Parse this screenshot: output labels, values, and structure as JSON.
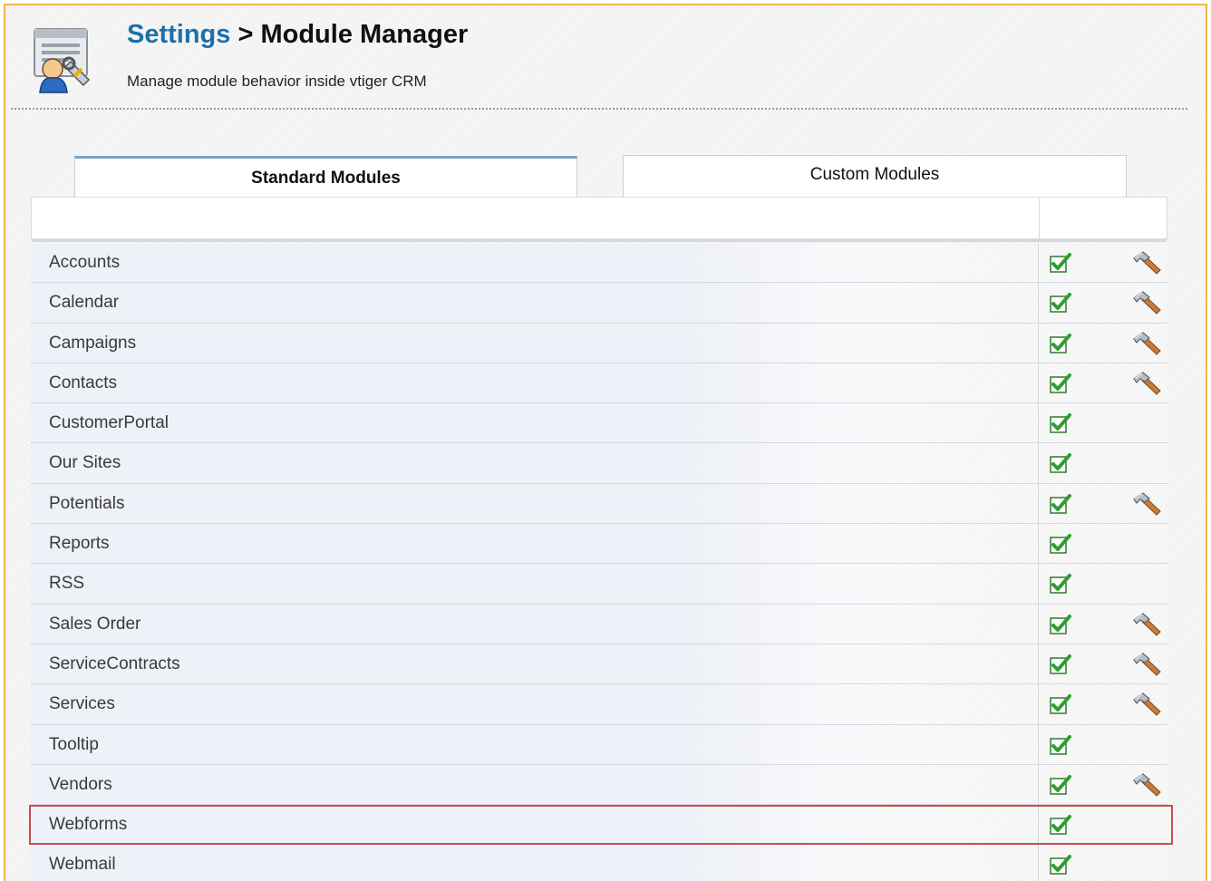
{
  "header": {
    "breadcrumb_link": "Settings",
    "breadcrumb_separator": ">",
    "breadcrumb_current": "Module Manager",
    "subtitle": "Manage module behavior inside vtiger CRM",
    "icon": "settings-admin-icon"
  },
  "tabs": [
    {
      "label": "Standard Modules",
      "active": true
    },
    {
      "label": "Custom Modules",
      "active": false
    }
  ],
  "colors": {
    "frame_border": "#f3b649",
    "link": "#1e6fa8",
    "active_tab_accent": "#7aa2c8",
    "highlight_border": "#cf4b52",
    "check_green": "#2f9e2f"
  },
  "modules": [
    {
      "name": "Accounts",
      "enabled": true,
      "has_settings": true
    },
    {
      "name": "Calendar",
      "enabled": true,
      "has_settings": true
    },
    {
      "name": "Campaigns",
      "enabled": true,
      "has_settings": true
    },
    {
      "name": "Contacts",
      "enabled": true,
      "has_settings": true
    },
    {
      "name": "CustomerPortal",
      "enabled": true,
      "has_settings": false
    },
    {
      "name": "Our Sites",
      "enabled": true,
      "has_settings": false
    },
    {
      "name": "Potentials",
      "enabled": true,
      "has_settings": true
    },
    {
      "name": "Reports",
      "enabled": true,
      "has_settings": false
    },
    {
      "name": "RSS",
      "enabled": true,
      "has_settings": false
    },
    {
      "name": "Sales Order",
      "enabled": true,
      "has_settings": true
    },
    {
      "name": "ServiceContracts",
      "enabled": true,
      "has_settings": true
    },
    {
      "name": "Services",
      "enabled": true,
      "has_settings": true
    },
    {
      "name": "Tooltip",
      "enabled": true,
      "has_settings": false
    },
    {
      "name": "Vendors",
      "enabled": true,
      "has_settings": true
    },
    {
      "name": "Webforms",
      "enabled": true,
      "has_settings": false,
      "highlighted": true
    },
    {
      "name": "Webmail",
      "enabled": true,
      "has_settings": false
    }
  ]
}
